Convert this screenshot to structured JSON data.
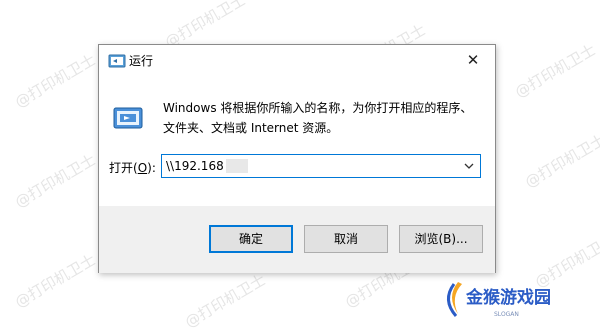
{
  "watermark": {
    "text": "@打印机卫士"
  },
  "dialog": {
    "title": "运行",
    "close_glyph": "✕",
    "description_line1": "Windows 将根据你所输入的名称，为你打开相应的程序、",
    "description_line2": "文件夹、文档或 Internet 资源。",
    "open_label_prefix": "打开(",
    "open_label_key": "O",
    "open_label_suffix": "):",
    "input_value": "\\\\192.168",
    "buttons": {
      "ok": "确定",
      "cancel": "取消",
      "browse": "浏览(B)..."
    },
    "icons": [
      "run-icon",
      "close-icon",
      "chevron-down-icon"
    ]
  },
  "logo": {
    "name": "金猴游戏园",
    "slogan": "SLOGAN",
    "colors": {
      "primary": "#2b5cc6",
      "accent": "#f5a623"
    }
  },
  "colors": {
    "focus": "#0078d7",
    "footer_bg": "#f0f0f0",
    "button_bg": "#e1e1e1"
  }
}
